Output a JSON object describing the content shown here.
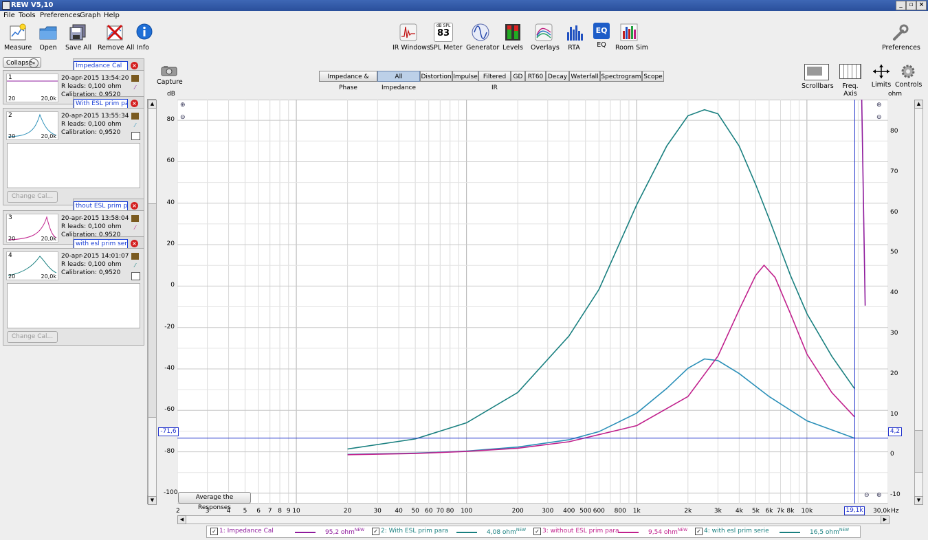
{
  "window": {
    "title": "REW V5,10",
    "buttons": [
      "_",
      "▫",
      "×"
    ]
  },
  "menu": [
    "File",
    "Tools",
    "Preferences",
    "Graph",
    "Help"
  ],
  "toolbar_left": [
    {
      "label": "Measure",
      "icon": "measure-icon"
    },
    {
      "label": "Open",
      "icon": "folder-icon"
    },
    {
      "label": "Save All",
      "icon": "save-all-icon"
    },
    {
      "label": "Remove All",
      "icon": "remove-all-icon"
    },
    {
      "label": "Info",
      "icon": "info-icon"
    }
  ],
  "toolbar_center": [
    {
      "label": "IR Windows",
      "icon": "ir-windows-icon"
    },
    {
      "label": "SPL Meter",
      "icon": "spl-meter-icon",
      "badge_top": "dB SPL",
      "badge_value": "83"
    },
    {
      "label": "Generator",
      "icon": "generator-icon"
    },
    {
      "label": "Levels",
      "icon": "levels-icon"
    },
    {
      "label": "Overlays",
      "icon": "overlays-icon"
    },
    {
      "label": "RTA",
      "icon": "rta-icon"
    },
    {
      "label": "EQ",
      "icon": "eq-icon",
      "badge_value": "EQ"
    },
    {
      "label": "Room Sim",
      "icon": "room-sim-icon"
    }
  ],
  "toolbar_right": {
    "label": "Preferences",
    "icon": "wrench-icon"
  },
  "left_panel": {
    "collapse_label": "Collapse",
    "collapse_icon": "«",
    "measurements": [
      {
        "num": "1",
        "name": "Impedance Cal",
        "date": "20-apr-2015 13:54:20",
        "leads": "R leads: 0,100 ohm",
        "cal": "Calibration: 0,9520",
        "lo": "20",
        "hi": "20,0k",
        "color": "#8e1a9c"
      },
      {
        "num": "2",
        "name": "With ESL prim para",
        "date": "20-apr-2015 13:55:34",
        "leads": "R leads: 0,100 ohm",
        "cal": "Calibration: 0,9520",
        "lo": "20",
        "hi": "20,0k",
        "color": "#2a8fb8"
      },
      {
        "num": "3",
        "name": "thout ESL prim para",
        "date": "20-apr-2015 13:58:04",
        "leads": "R leads: 0,100 ohm",
        "cal": "Calibration: 0,9520",
        "lo": "20",
        "hi": "20,0k",
        "color": "#c0208c"
      },
      {
        "num": "4",
        "name": "with esl prim serie",
        "date": "20-apr-2015 14:01:07",
        "leads": "R leads: 0,100 ohm",
        "cal": "Calibration: 0,9520",
        "lo": "20",
        "hi": "20,0k",
        "color": "#187f7f"
      }
    ],
    "change_cal_label": "Change Cal..."
  },
  "capture": {
    "label": "Capture",
    "icon": "camera-icon"
  },
  "graph_tabs": [
    {
      "label": "Impedance & Phase",
      "selected": false
    },
    {
      "label": "All Impedance",
      "selected": true
    },
    {
      "label": "Distortion",
      "selected": false
    },
    {
      "label": "Impulse",
      "selected": false
    },
    {
      "label": "Filtered IR",
      "selected": false
    },
    {
      "label": "GD",
      "selected": false
    },
    {
      "label": "RT60",
      "selected": false
    },
    {
      "label": "Decay",
      "selected": false
    },
    {
      "label": "Waterfall",
      "selected": false
    },
    {
      "label": "Spectrogram",
      "selected": false
    },
    {
      "label": "Scope",
      "selected": false
    }
  ],
  "right_tools": [
    {
      "label": "Scrollbars",
      "icon": "scrollbars-icon"
    },
    {
      "label": "Freq. Axis",
      "icon": "freq-axis-icon"
    },
    {
      "label": "Limits",
      "icon": "limits-icon"
    },
    {
      "label": "Controls",
      "icon": "controls-icon"
    }
  ],
  "graph": {
    "average_button": "Average the Responses",
    "cursor_left_readout": "-71,6",
    "cursor_right_readout": "4,2",
    "cursor_freq_readout": "19,1k"
  },
  "chart_data": {
    "type": "line",
    "title": "",
    "xlabel": "Hz",
    "ylabel": "dB",
    "y2label": "ohm",
    "x_scale": "log",
    "xlim": [
      2,
      30000
    ],
    "ylim": [
      -105,
      90
    ],
    "y2lim": [
      -12,
      88
    ],
    "grid": true,
    "x_ticks": [
      {
        "v": 2,
        "l": "2"
      },
      {
        "v": 3,
        "l": "3"
      },
      {
        "v": 4,
        "l": "4"
      },
      {
        "v": 5,
        "l": "5"
      },
      {
        "v": 6,
        "l": "6"
      },
      {
        "v": 7,
        "l": "7"
      },
      {
        "v": 8,
        "l": "8"
      },
      {
        "v": 9,
        "l": "9"
      },
      {
        "v": 10,
        "l": "10"
      },
      {
        "v": 20,
        "l": "20"
      },
      {
        "v": 30,
        "l": "30"
      },
      {
        "v": 40,
        "l": "40"
      },
      {
        "v": 50,
        "l": "50"
      },
      {
        "v": 60,
        "l": "60"
      },
      {
        "v": 70,
        "l": "70"
      },
      {
        "v": 80,
        "l": "80"
      },
      {
        "v": 100,
        "l": "100"
      },
      {
        "v": 200,
        "l": "200"
      },
      {
        "v": 300,
        "l": "300"
      },
      {
        "v": 400,
        "l": "400"
      },
      {
        "v": 500,
        "l": "500"
      },
      {
        "v": 600,
        "l": "600"
      },
      {
        "v": 800,
        "l": "800"
      },
      {
        "v": 1000,
        "l": "1k"
      },
      {
        "v": 2000,
        "l": "2k"
      },
      {
        "v": 3000,
        "l": "3k"
      },
      {
        "v": 4000,
        "l": "4k"
      },
      {
        "v": 5000,
        "l": "5k"
      },
      {
        "v": 6000,
        "l": "6k"
      },
      {
        "v": 7000,
        "l": "7k"
      },
      {
        "v": 8000,
        "l": "8k"
      },
      {
        "v": 10000,
        "l": "10k"
      },
      {
        "v": 30000,
        "l": "30,0k"
      }
    ],
    "y_ticks": [
      80,
      60,
      40,
      20,
      0,
      -20,
      -40,
      -60,
      -80,
      -100
    ],
    "y_tick_labels": [
      "80",
      "60",
      "40",
      "20",
      "0",
      "-20",
      "-40",
      "-60",
      "-80",
      "-100"
    ],
    "y2_ticks": [
      80,
      70,
      60,
      50,
      40,
      30,
      20,
      10,
      0,
      -10
    ],
    "y2_tick_labels": [
      "80",
      "70",
      "60",
      "50",
      "40",
      "30",
      "20",
      "10",
      "0",
      "-10"
    ],
    "x_unit_label": "Hz",
    "cursor": {
      "freq": 19100,
      "ohm": 4.2,
      "db": -71.6
    },
    "series": [
      {
        "name": "1: Impedance Cal",
        "color": "#8e1a9c",
        "axis": "y2",
        "x": [
          21000,
          22000
        ],
        "y": [
          88,
          37
        ]
      },
      {
        "name": "2: With ESL prim para",
        "color": "#2a8fb8",
        "axis": "y2",
        "x": [
          20,
          50,
          100,
          200,
          400,
          600,
          1000,
          1500,
          2000,
          2500,
          3000,
          4000,
          6000,
          10000,
          19000
        ],
        "y": [
          0.2,
          0.5,
          1.0,
          2.0,
          3.8,
          5.8,
          10.4,
          16.5,
          21.5,
          23.8,
          23.4,
          20.2,
          14.5,
          8.5,
          4.2
        ]
      },
      {
        "name": "3: without ESL prim para",
        "color": "#c0208c",
        "axis": "y2",
        "x": [
          20,
          50,
          100,
          200,
          400,
          1000,
          2000,
          3000,
          4000,
          5000,
          5600,
          6500,
          8000,
          10000,
          14000,
          19000
        ],
        "y": [
          0.1,
          0.4,
          0.9,
          1.7,
          3.3,
          7.3,
          14.5,
          24.5,
          36.0,
          44.5,
          47.0,
          44.0,
          35.0,
          25.0,
          15.5,
          9.5
        ]
      },
      {
        "name": "4: with esl prim serie",
        "color": "#187f7f",
        "axis": "y2",
        "x": [
          20,
          50,
          100,
          200,
          400,
          600,
          1000,
          1500,
          2000,
          2500,
          3000,
          4000,
          5000,
          6000,
          8000,
          10000,
          14000,
          19000
        ],
        "y": [
          1.5,
          4.0,
          8.0,
          15.5,
          29.5,
          41.0,
          62.0,
          76.5,
          84.0,
          85.5,
          84.5,
          76.5,
          67.0,
          58.5,
          44.5,
          35.0,
          24.5,
          16.5
        ]
      }
    ]
  },
  "legend": [
    {
      "label": "1: Impedance Cal",
      "value": "95,2 ohm",
      "tag": "NEW",
      "color": "#8e1a9c"
    },
    {
      "label": "2: With ESL prim para",
      "value": "4,08 ohm",
      "tag": "NEW",
      "color": "#187f7f"
    },
    {
      "label": "3: without ESL prim para",
      "value": "9,54 ohm",
      "tag": "NEW",
      "color": "#c0208c"
    },
    {
      "label": "4: with esl prim serie",
      "value": "16,5 ohm",
      "tag": "NEW",
      "color": "#187f7f"
    }
  ]
}
